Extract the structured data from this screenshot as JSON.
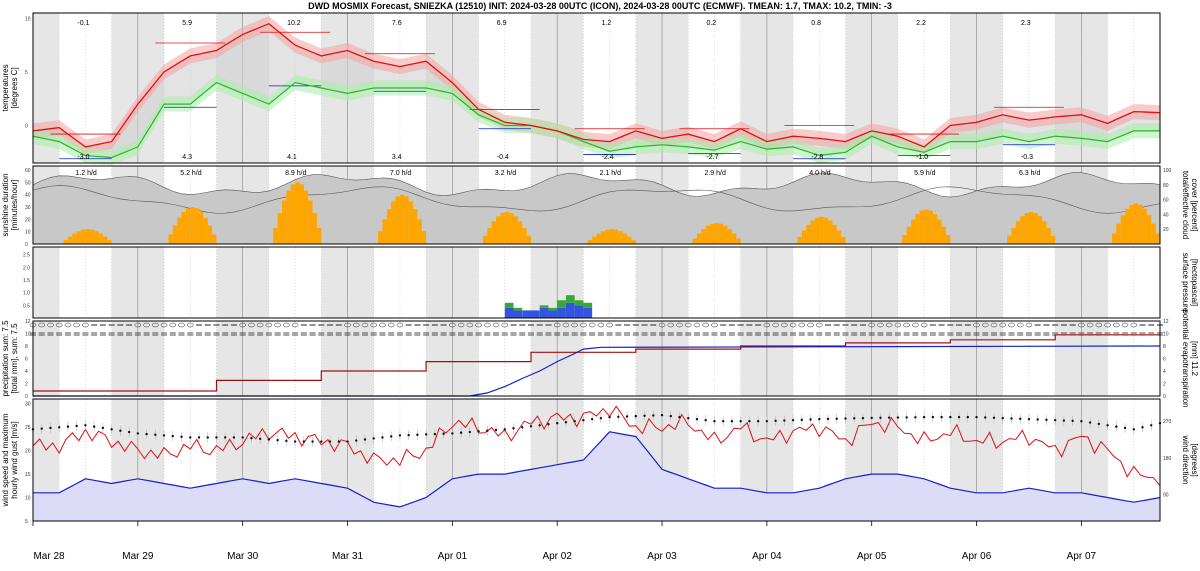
{
  "title": "DWD MOSMIX Forecast, SNIEZKA (12510) INIT: 2024-03-28 00UTC (ICON), 2024-03-28 00UTC (ECMWF). TMEAN: 1.7, TMAX: 10.2, TMIN: -3",
  "colors": {
    "icon_red": "#dd1111",
    "ecmwf_green": "#22bb22",
    "blue_line": "#1122cc",
    "sunshine": "#ffa500",
    "cloud_fill": "#c8c8c8",
    "wind_fill": "#dcdcf8",
    "night_shade": "#e6e6e6",
    "precip_blue": "#3355dd",
    "precip_green": "#33aa33"
  },
  "chart_data": [
    {
      "type": "line",
      "panel": "temperatures",
      "ylabel": [
        "temperatures",
        "[degrees C]"
      ],
      "ylim": [
        -3.5,
        10.5
      ],
      "y_ticks": [
        0,
        5,
        10
      ],
      "x_days": [
        "Mar 28",
        "Mar 29",
        "Mar 30",
        "Mar 31",
        "Apr 01",
        "Apr 02",
        "Apr 03",
        "Apr 04",
        "Apr 05",
        "Apr 06",
        "Apr 07"
      ],
      "daily_max_labels": [
        "-0.1",
        "5.9",
        "10.2",
        "7.6",
        "6.9",
        "1.2",
        "0.2",
        "0.8",
        "2.2",
        "2.3"
      ],
      "daily_min_labels": [
        "-3.0",
        "4.3",
        "4.1",
        "3.4",
        "-0.4",
        "-2.4",
        "-2.7",
        "-2.8",
        "-1.0",
        "-0.3"
      ],
      "series": [
        {
          "name": "ICON",
          "color": "red",
          "x": [
            0,
            6,
            12,
            18,
            24,
            30,
            36,
            42,
            48,
            54,
            60,
            66,
            72,
            78,
            84,
            90,
            96,
            102,
            108,
            114,
            120,
            126,
            132,
            138,
            144,
            150,
            156,
            162,
            168,
            174,
            180,
            186,
            192,
            198,
            204,
            210,
            216,
            222,
            228,
            234,
            240,
            246,
            252,
            258
          ],
          "values": [
            -0.5,
            -0.2,
            -2.0,
            -1.5,
            2.0,
            5.0,
            6.5,
            7.0,
            8.5,
            9.5,
            7.5,
            6.5,
            7.0,
            6.0,
            5.5,
            6.0,
            4.0,
            1.5,
            0.3,
            0.0,
            -0.5,
            -1.3,
            -1.5,
            -0.5,
            -1.2,
            -0.8,
            -1.5,
            -0.3,
            -1.5,
            -1.0,
            -1.2,
            -1.5,
            -0.5,
            -1.0,
            -2.0,
            0.0,
            0.3,
            1.0,
            0.5,
            0.8,
            1.0,
            0.2,
            1.3,
            1.2
          ]
        },
        {
          "name": "ECMWF",
          "color": "green",
          "x": [
            0,
            6,
            12,
            18,
            24,
            30,
            36,
            42,
            48,
            54,
            60,
            66,
            72,
            78,
            84,
            90,
            96,
            102,
            108,
            114,
            120,
            126,
            132,
            138,
            144,
            150,
            156,
            162,
            168,
            174,
            180,
            186,
            192,
            198,
            204,
            210,
            216,
            222,
            228,
            234,
            240,
            246,
            252,
            258
          ],
          "values": [
            -1.0,
            -1.5,
            -2.8,
            -3.0,
            -2.0,
            2.0,
            2.0,
            4.0,
            3.0,
            2.0,
            4.0,
            3.5,
            3.0,
            3.5,
            3.5,
            3.5,
            3.0,
            1.0,
            0.0,
            0.0,
            -0.5,
            -1.5,
            -2.4,
            -2.0,
            -1.8,
            -2.0,
            -2.3,
            -1.5,
            -2.2,
            -2.0,
            -2.8,
            -2.5,
            -1.0,
            -2.0,
            -2.5,
            -1.5,
            -1.5,
            -1.0,
            -1.5,
            -1.0,
            -1.2,
            -1.5,
            -0.5,
            -0.5
          ]
        }
      ]
    },
    {
      "type": "bar",
      "panel": "sunshine and cloud cover",
      "ylabel_left": [
        "sunshine duration",
        "[minutes/hour]"
      ],
      "ylabel_right": [
        "total/effective cloud",
        "cover [percent]"
      ],
      "ylim_left": [
        0,
        60
      ],
      "ylim_right": [
        0,
        100
      ],
      "y_ticks_left": [
        0,
        10,
        20,
        30,
        40,
        50,
        60
      ],
      "y_ticks_right": [
        20,
        40,
        60,
        80,
        100
      ],
      "daily_sun_labels": [
        "1.2 h/d",
        "5.2 h/d",
        "8.9 h/d",
        "7.0 h/d",
        "3.2 h/d",
        "2.1 h/d",
        "2.9 h/d",
        "4.0 h/d",
        "5.9 h/d",
        "6.3 h/d"
      ],
      "sunshine_days": [
        {
          "day": 0,
          "peak": 12
        },
        {
          "day": 1,
          "peak": 30
        },
        {
          "day": 2,
          "peak": 50
        },
        {
          "day": 3,
          "peak": 40
        },
        {
          "day": 4,
          "peak": 26
        },
        {
          "day": 5,
          "peak": 12
        },
        {
          "day": 6,
          "peak": 17
        },
        {
          "day": 7,
          "peak": 22
        },
        {
          "day": 8,
          "peak": 28
        },
        {
          "day": 9,
          "peak": 26
        },
        {
          "day": 10,
          "peak": 33
        }
      ]
    },
    {
      "type": "bar",
      "panel": "surface pressure",
      "ylabel_right": [
        "surface pressure",
        "[hectopascal]"
      ],
      "y_ticks": [
        0.5,
        1.0,
        1.5,
        2.0,
        2.5
      ],
      "ylim": [
        0,
        2.8
      ],
      "bars": {
        "x_hours": [
          108,
          110,
          112,
          114,
          116,
          118,
          120,
          122,
          124,
          126
        ],
        "blue": [
          0.4,
          0.3,
          0.3,
          0.3,
          0.4,
          0.3,
          0.4,
          0.6,
          0.5,
          0.4
        ],
        "green": [
          0.2,
          0.1,
          0.0,
          0.0,
          0.1,
          0.1,
          0.3,
          0.3,
          0.2,
          0.2
        ]
      }
    },
    {
      "type": "line",
      "panel": "precipitation",
      "ylabel_left": [
        "precipitation sum: 7.5",
        "[total mm], sum: 7.5"
      ],
      "ylabel_right": [
        "potential evapotranspiration",
        "[mm] 11.2"
      ],
      "ylim": [
        0,
        12
      ],
      "y_ticks": [
        0,
        2,
        4,
        6,
        8,
        10,
        12
      ],
      "series": [
        {
          "name": "precipitation sum",
          "color": "darkred",
          "x": [
            0,
            42,
            42,
            66,
            66,
            90,
            90,
            114,
            114,
            138,
            138,
            162,
            162,
            186,
            186,
            210,
            210,
            234,
            234,
            258
          ],
          "values": [
            0.8,
            0.8,
            2.5,
            2.5,
            4.0,
            4.0,
            5.5,
            5.5,
            7.0,
            7.0,
            7.5,
            7.5,
            8.0,
            8.0,
            8.5,
            8.5,
            9.0,
            9.0,
            9.8,
            9.8
          ]
        },
        {
          "name": "potential evapotranspiration",
          "color": "blue",
          "x": [
            0,
            100,
            104,
            108,
            112,
            116,
            120,
            124,
            126,
            130,
            258
          ],
          "values": [
            0,
            0,
            0.5,
            1.5,
            2.8,
            4.0,
            5.5,
            6.8,
            7.5,
            7.8,
            8.0
          ]
        }
      ]
    },
    {
      "type": "line",
      "panel": "wind",
      "ylabel_left": [
        "wind speed and maximum",
        "hourly wind gust [m/s]"
      ],
      "ylabel_right": [
        "wind direction",
        "[degrees]"
      ],
      "ylim": [
        5,
        31
      ],
      "y_ticks_left": [
        5,
        10,
        15,
        20,
        25,
        30
      ],
      "y_ticks_right": [
        90,
        180,
        270
      ],
      "series": [
        {
          "name": "wind speed",
          "color": "blue",
          "x": [
            0,
            6,
            12,
            18,
            24,
            30,
            36,
            42,
            48,
            54,
            60,
            66,
            72,
            78,
            84,
            90,
            96,
            102,
            108,
            114,
            120,
            126,
            132,
            138,
            144,
            150,
            156,
            162,
            168,
            174,
            180,
            186,
            192,
            198,
            204,
            210,
            216,
            222,
            228,
            234,
            240,
            246,
            252,
            258
          ],
          "values": [
            11,
            11,
            14,
            13,
            14,
            13,
            12,
            13,
            14,
            13,
            14,
            13,
            12,
            9,
            8,
            10,
            14,
            15,
            15,
            16,
            17,
            18,
            24,
            23,
            16,
            14,
            12,
            12,
            11,
            11,
            12,
            14,
            15,
            15,
            14,
            12,
            11,
            11,
            12,
            11,
            11,
            10,
            9,
            10
          ]
        },
        {
          "name": "maximum hourly wind gust",
          "color": "red",
          "x": [
            0,
            6,
            12,
            18,
            24,
            30,
            36,
            42,
            48,
            54,
            60,
            66,
            72,
            78,
            84,
            90,
            96,
            102,
            108,
            114,
            120,
            126,
            132,
            138,
            144,
            150,
            156,
            162,
            168,
            174,
            180,
            186,
            192,
            198,
            204,
            210,
            216,
            222,
            228,
            234,
            240,
            246,
            252,
            258
          ],
          "values": [
            21,
            21,
            24,
            22,
            20,
            19,
            21,
            20,
            22,
            24,
            23,
            22,
            21,
            18,
            18,
            20,
            26,
            25,
            23,
            26,
            27,
            27,
            29,
            25,
            25,
            26,
            22,
            25,
            22,
            24,
            25,
            22,
            26,
            25,
            22,
            24,
            22,
            22,
            23,
            20,
            23,
            20,
            15,
            14
          ]
        },
        {
          "name": "wind direction",
          "color": "black",
          "x": [
            0,
            12,
            24,
            36,
            48,
            60,
            72,
            84,
            96,
            108,
            120,
            132,
            144,
            156,
            168,
            180,
            192,
            204,
            216,
            228,
            240,
            252,
            258
          ],
          "values": [
            250,
            260,
            240,
            230,
            230,
            220,
            220,
            235,
            240,
            250,
            265,
            280,
            285,
            270,
            270,
            275,
            278,
            280,
            280,
            275,
            270,
            250,
            265
          ]
        }
      ]
    }
  ]
}
